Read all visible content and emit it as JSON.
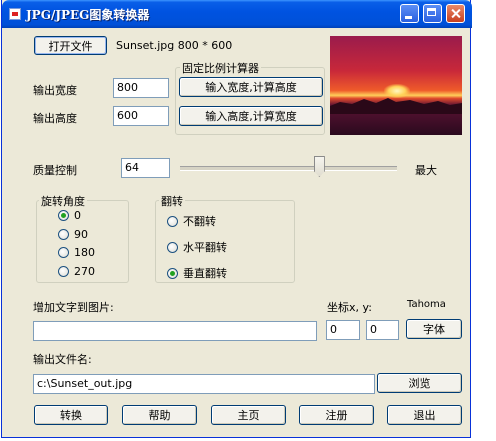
{
  "window": {
    "title": "JPG/JPEG图象转换器"
  },
  "file": {
    "open_button": "打开文件",
    "info": "Sunset.jpg 800 * 600"
  },
  "size": {
    "width_label": "输出宽度",
    "width_value": "800",
    "height_label": "输出高度",
    "height_value": "600",
    "calc_group": "固定比例计算器",
    "calc_height_button": "输入宽度,计算高度",
    "calc_width_button": "输入高度,计算宽度"
  },
  "quality": {
    "label": "质量控制",
    "value": "64",
    "max_label": "最大",
    "slider_fraction": 0.64
  },
  "rotation": {
    "group_title": "旋转角度",
    "options": [
      "0",
      "90",
      "180",
      "270"
    ],
    "selected": "0"
  },
  "flip": {
    "group_title": "翻转",
    "options": [
      "不翻转",
      "水平翻转",
      "垂直翻转"
    ],
    "selected": "垂直翻转"
  },
  "text_overlay": {
    "label": "增加文字到图片:",
    "value": "",
    "coord_label": "坐标x, y:",
    "x": "0",
    "y": "0",
    "font_name": "Tahoma",
    "font_button": "字体"
  },
  "output": {
    "label": "输出文件名:",
    "value": "c:\\Sunset_out.jpg",
    "browse_button": "浏览"
  },
  "actions": {
    "convert": "转换",
    "help": "帮助",
    "home": "主页",
    "register": "注册",
    "exit": "退出"
  },
  "icons": {
    "app": "app-icon",
    "minimize": "minimize-icon",
    "maximize": "maximize-icon",
    "close": "close-icon"
  }
}
